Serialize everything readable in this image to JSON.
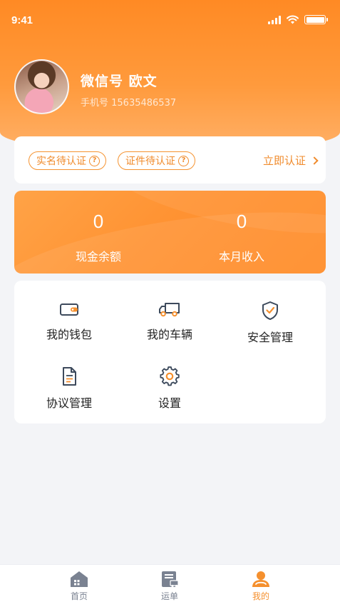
{
  "status_bar": {
    "time": "9:41"
  },
  "profile": {
    "username": "微信号  欧文",
    "phone": "手机号 15635486537"
  },
  "verify": {
    "pill_realname": "实名待认证",
    "pill_docs": "证件待认证",
    "link": "立即认证"
  },
  "balance": {
    "cash_value": "0",
    "cash_label": "现金余额",
    "income_value": "0",
    "income_label": "本月收入"
  },
  "menu": {
    "items": [
      {
        "label": "我的钱包",
        "icon": "wallet-icon"
      },
      {
        "label": "我的车辆",
        "icon": "truck-icon"
      },
      {
        "label": "安全管理",
        "icon": "shield-check-icon"
      },
      {
        "label": "协议管理",
        "icon": "document-icon"
      },
      {
        "label": "设置",
        "icon": "gear-icon"
      }
    ]
  },
  "tabbar": {
    "tabs": [
      {
        "label": "首页",
        "icon": "home-icon",
        "active": false
      },
      {
        "label": "运单",
        "icon": "waybill-icon",
        "active": false
      },
      {
        "label": "我的",
        "icon": "user-icon",
        "active": true
      }
    ]
  },
  "colors": {
    "accent": "#f5902e",
    "header_top": "#ff8a24",
    "header_bottom": "#ffb169",
    "tab_inactive": "#7a8291",
    "page_bg": "#f3f4f7"
  }
}
